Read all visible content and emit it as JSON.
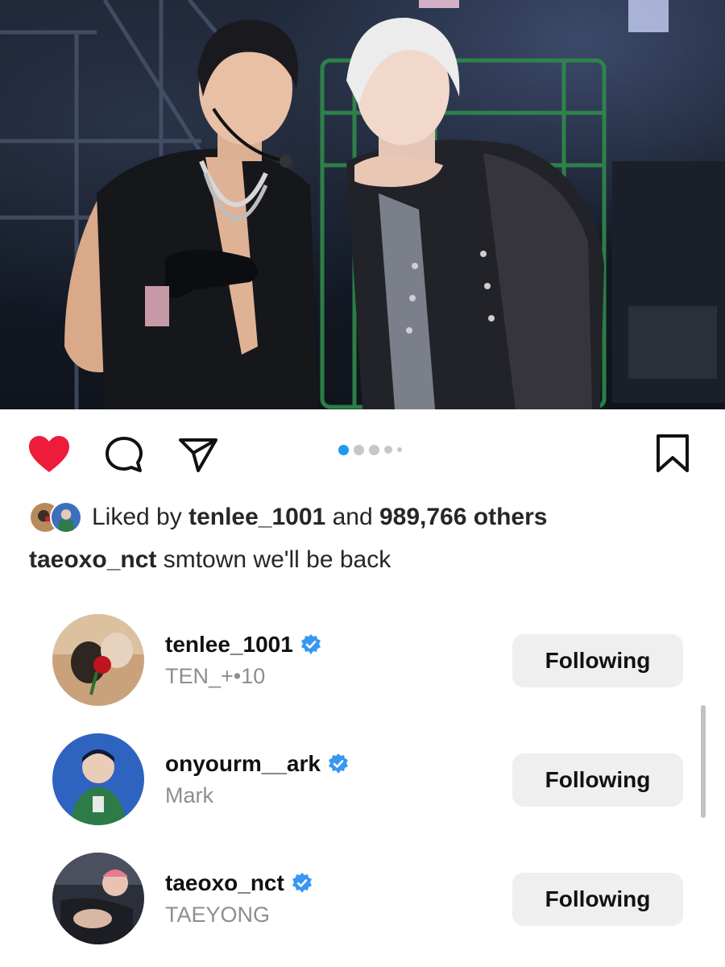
{
  "post": {
    "image_alt": "Two performers posing backstage",
    "carousel_dots": 5,
    "carousel_active": 1
  },
  "actions": {
    "like_icon": "heart-filled-icon",
    "comment_icon": "comment-icon",
    "share_icon": "send-icon",
    "save_icon": "bookmark-icon",
    "like_color": "#ed1c3b",
    "active_dot_color": "#1d9bf0"
  },
  "likes": {
    "prefix": "Liked by",
    "user": "tenlee_1001",
    "and": "and",
    "count": "989,766 others"
  },
  "caption": {
    "user": "taeoxo_nct",
    "text": "smtown we'll be back"
  },
  "following": [
    {
      "username": "tenlee_1001",
      "full_name": "TEN_+•10",
      "verified": true,
      "button": "Following"
    },
    {
      "username": "onyourm__ark",
      "full_name": "Mark",
      "verified": true,
      "button": "Following"
    },
    {
      "username": "taeoxo_nct",
      "full_name": "TAEYONG",
      "verified": true,
      "button": "Following"
    }
  ],
  "colors": {
    "verified_badge": "#3897f0",
    "button_bg": "#efefef"
  }
}
